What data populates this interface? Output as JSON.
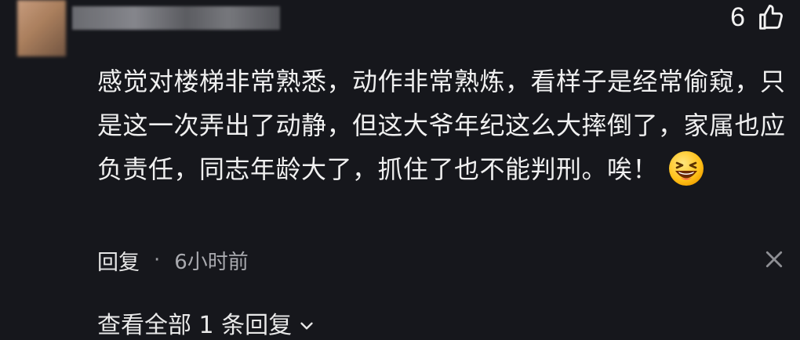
{
  "comment": {
    "like_count": "6",
    "text": "感觉对楼梯非常熟悉，动作非常熟炼，看样子是经常偷窥，只是这一次弄出了动静，但这大爷年纪这么大摔倒了，家属也应负责任，同志年龄大了，抓住了也不能判刑。唉！",
    "reply_label": "回复",
    "separator": "·",
    "time_ago": "6小时前",
    "view_all_replies": "查看全部 1 条回复"
  },
  "icons": {
    "like": "thumbs-up-icon",
    "emoji": "laughing-emoji-icon",
    "close": "close-icon",
    "expand": "chevron-down-icon"
  },
  "colors": {
    "background": "#16171c",
    "text": "#f0f0f0",
    "secondary_text": "#a9aaaf"
  }
}
